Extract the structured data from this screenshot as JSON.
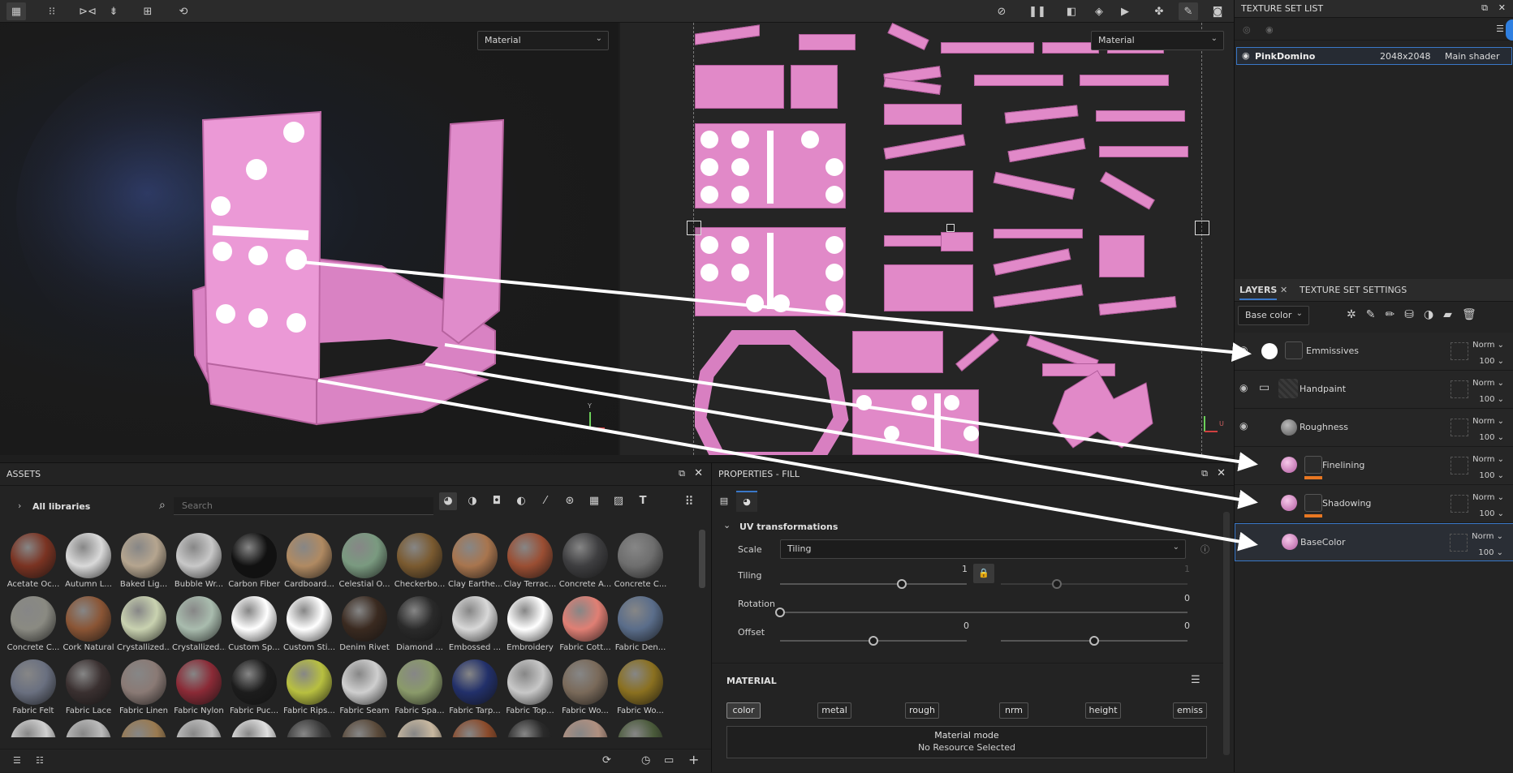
{
  "toolbar": {
    "left_icons": [
      "layers-grid-icon",
      "grid-dots-icon",
      "mirror-icon",
      "symmetry-icon",
      "frame-icon",
      "history-icon"
    ],
    "right_icons": [
      "hide-ui-icon",
      "pause-icon",
      "split-view-icon",
      "cube-icon",
      "camera-video-icon",
      "paint-tool-icon",
      "brush-icon",
      "screenshot-icon"
    ]
  },
  "viewport": {
    "left_dropdown": "Material",
    "right_dropdown": "Material",
    "axis_y": "Y",
    "axis_u": "U"
  },
  "texture_set_list": {
    "title": "TEXTURE SET LIST",
    "row": {
      "name": "PinkDomino",
      "resolution": "2048x2048",
      "shader": "Main shader"
    }
  },
  "layers_panel": {
    "tab_layers": "LAYERS",
    "tab_settings": "TEXTURE SET SETTINGS",
    "channel": "Base color",
    "layers": [
      {
        "name": "Emmissives",
        "blend": "Norm",
        "opacity": "100",
        "type": "fill-white"
      },
      {
        "name": "Handpaint",
        "blend": "Norm",
        "opacity": "100",
        "type": "paint-folder"
      },
      {
        "name": "Roughness",
        "blend": "Norm",
        "opacity": "100",
        "type": "fill-grey"
      },
      {
        "name": "Finelining",
        "blend": "Norm",
        "opacity": "100",
        "type": "fill-pink-mask"
      },
      {
        "name": "Shadowing",
        "blend": "Norm",
        "opacity": "100",
        "type": "fill-pink-mask"
      },
      {
        "name": "BaseColor",
        "blend": "Norm",
        "opacity": "100",
        "type": "fill-pink"
      }
    ]
  },
  "assets": {
    "title": "ASSETS",
    "library": "All libraries",
    "search_placeholder": "Search",
    "items": [
      {
        "label": "Acetate Oc...",
        "color": "#7a3322"
      },
      {
        "label": "Autumn L...",
        "color": "#d9d9d9"
      },
      {
        "label": "Baked Lig...",
        "color": "#b5a58f"
      },
      {
        "label": "Bubble Wr...",
        "color": "#c8c8c8"
      },
      {
        "label": "Carbon Fiber",
        "color": "#111111"
      },
      {
        "label": "Cardboard...",
        "color": "#b08a62"
      },
      {
        "label": "Celestial O...",
        "color": "#7a9a80"
      },
      {
        "label": "Checkerbo...",
        "color": "#7a5a30"
      },
      {
        "label": "Clay Earthe...",
        "color": "#a8754e"
      },
      {
        "label": "Clay Terrac...",
        "color": "#9a4e33"
      },
      {
        "label": "Concrete A...",
        "color": "#3e3e40"
      },
      {
        "label": "Concrete C...",
        "color": "#6e6e6e"
      },
      {
        "label": "Concrete C...",
        "color": "#8a8a82"
      },
      {
        "label": "Cork Natural",
        "color": "#8a5535"
      },
      {
        "label": "Crystallized...",
        "color": "#c9d2b0"
      },
      {
        "label": "Crystallized...",
        "color": "#a9bcae"
      },
      {
        "label": "Custom Sp...",
        "color": "#ffffff"
      },
      {
        "label": "Custom Sti...",
        "color": "#ffffff"
      },
      {
        "label": "Denim Rivet",
        "color": "#3a2a20"
      },
      {
        "label": "Diamond ...",
        "color": "#2a2a2a"
      },
      {
        "label": "Embossed ...",
        "color": "#d8d8d8"
      },
      {
        "label": "Embroidery",
        "color": "#ffffff"
      },
      {
        "label": "Fabric Cott...",
        "color": "#e07f74"
      },
      {
        "label": "Fabric Den...",
        "color": "#5a6d8a"
      },
      {
        "label": "Fabric Felt",
        "color": "#6a7080"
      },
      {
        "label": "Fabric Lace",
        "color": "#3a3030"
      },
      {
        "label": "Fabric Linen",
        "color": "#8a7a75"
      },
      {
        "label": "Fabric Nylon",
        "color": "#8a2a36"
      },
      {
        "label": "Fabric Puc...",
        "color": "#1c1c1c"
      },
      {
        "label": "Fabric Rips...",
        "color": "#b8c040"
      },
      {
        "label": "Fabric Seam",
        "color": "#cfcfcf"
      },
      {
        "label": "Fabric Spa...",
        "color": "#8a9a6a"
      },
      {
        "label": "Fabric Tarp...",
        "color": "#22306a"
      },
      {
        "label": "Fabric Top...",
        "color": "#c8c8c8"
      },
      {
        "label": "Fabric Wo...",
        "color": "#7a6a5a"
      },
      {
        "label": "Fabric Wo...",
        "color": "#8a7020"
      }
    ],
    "last_row_colors": [
      "#d0d0d0",
      "#bbbbbb",
      "#9a7a50",
      "#bfbfbf",
      "#e0e0e0",
      "#3a3a3a",
      "#5a4a3a",
      "#c8b8a0",
      "#8a4a2a",
      "#2a2a2a",
      "#b09080",
      "#4a5a3a"
    ]
  },
  "properties": {
    "title": "PROPERTIES - FILL",
    "section": "UV transformations",
    "scale_label": "Scale",
    "scale_value": "Tiling",
    "tiling_label": "Tiling",
    "tiling_value": "1",
    "tiling_value2": "1",
    "rotation_label": "Rotation",
    "rotation_value": "0",
    "offset_label": "Offset",
    "offset_value": "0",
    "offset_value2": "0",
    "material_title": "MATERIAL",
    "channels": [
      "color",
      "metal",
      "rough",
      "nrm",
      "height",
      "emiss"
    ],
    "material_mode_label": "Material mode",
    "material_mode_value": "No Resource Selected",
    "tiling_fraction": 0.65,
    "tiling2_fraction": 0.3,
    "rotation_fraction": 0.0,
    "offset_fraction": 0.5,
    "offset2_fraction": 0.5
  },
  "colors": {
    "accent": "#3a78c8",
    "pink": "#e189c8",
    "mask_bar": "#e87722"
  }
}
